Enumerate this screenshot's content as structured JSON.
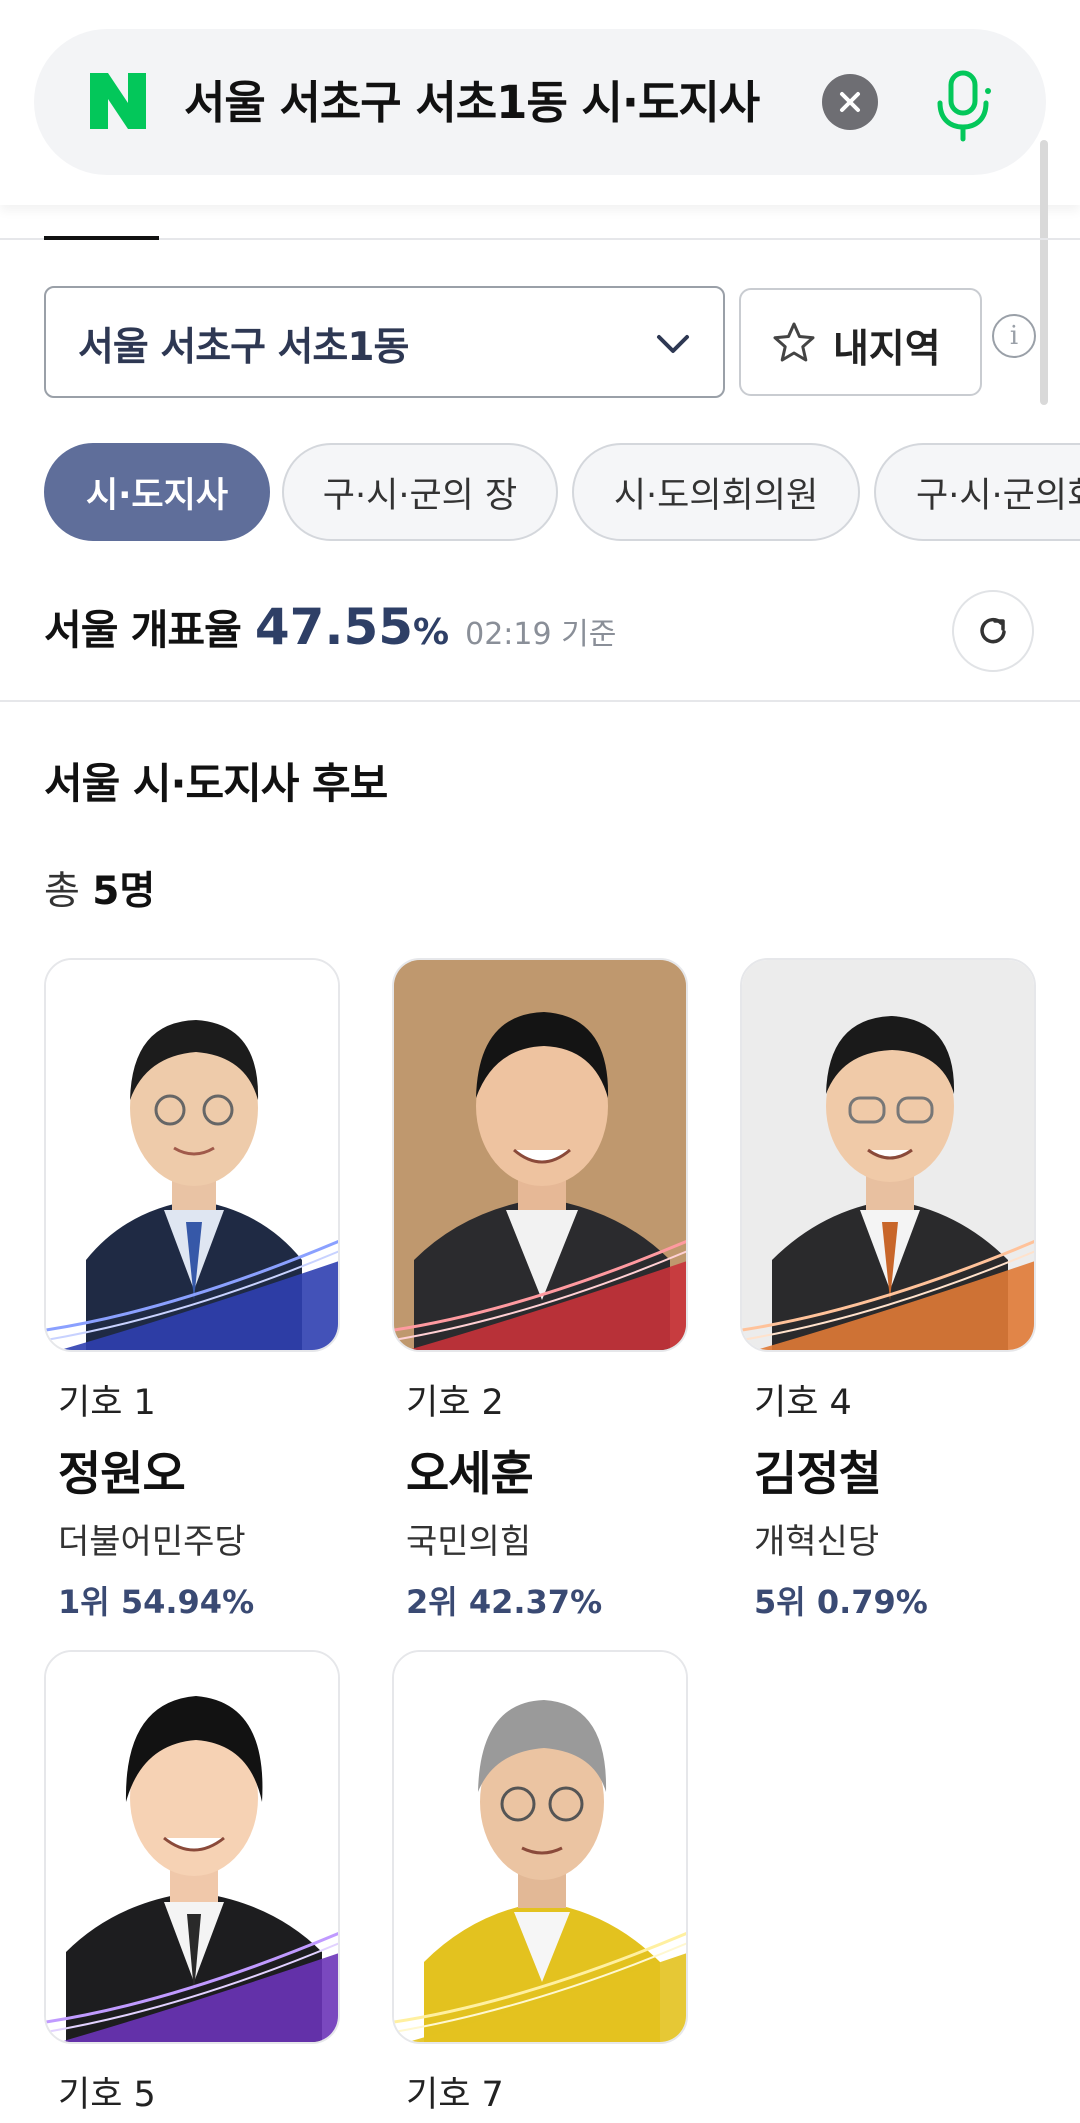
{
  "search": {
    "query": "서울 서초구 서초1동  시·도지사",
    "clear_icon": "close-icon",
    "mic_icon": "microphone-icon"
  },
  "region": {
    "selected": "서울 서초구 서초1동",
    "my_region_label": "내지역"
  },
  "chips": [
    {
      "label": "시·도지사",
      "active": true
    },
    {
      "label": "구·시·군의 장",
      "active": false
    },
    {
      "label": "시·도의회의원",
      "active": false
    },
    {
      "label": "구·시·군의회",
      "active": false
    }
  ],
  "counting": {
    "label": "서울 개표율",
    "value": "47.55",
    "unit": "%",
    "time": "02:19 기준"
  },
  "section": {
    "title": "서울 시·도지사 후보",
    "total_prefix": "총",
    "total_count": "5명"
  },
  "candidates": [
    {
      "number": "기호 1",
      "name": "정원오",
      "party": "더불어민주당",
      "result": "1위 54.94%",
      "color": "#2f3fb0"
    },
    {
      "number": "기호 2",
      "name": "오세훈",
      "party": "국민의힘",
      "result": "2위 42.37%",
      "color": "#c8323a"
    },
    {
      "number": "기호 4",
      "name": "김정철",
      "party": "개혁신당",
      "result": "5위 0.79%",
      "color": "#e07a36"
    },
    {
      "number": "기호 5",
      "name": "",
      "party": "",
      "result": "",
      "color": "#6b34b8"
    },
    {
      "number": "기호 7",
      "name": "",
      "party": "",
      "result": "",
      "color": "#e3c21f"
    }
  ],
  "colors": {
    "accent": "#5f6e9a",
    "naver_green": "#03c75a",
    "rate_text": "#2e3f66"
  }
}
